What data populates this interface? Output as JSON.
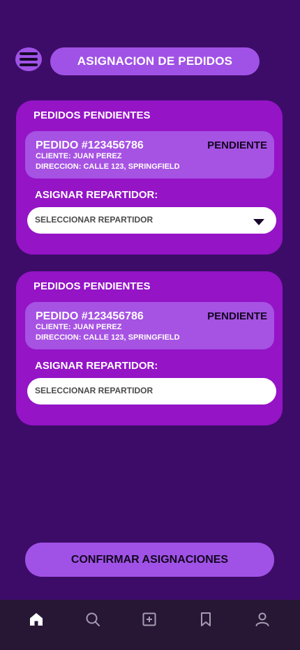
{
  "header": {
    "title": "ASIGNACION DE PEDIDOS",
    "menu_icon": "menu-icon"
  },
  "cards": [
    {
      "title": "PEDIDOS PENDIENTES",
      "order_id": "PEDIDO #123456786",
      "status": "PENDIENTE",
      "client": "CLIENTE: JUAN PEREZ",
      "address": "DIRECCION: CALLE 123, SPRINGFIELD",
      "assign_label": "ASIGNAR REPARTIDOR:",
      "select_value": "SELECCIONAR REPARTIDOR",
      "has_dropdown_icon": true
    },
    {
      "title": "PEDIDOS PENDIENTES",
      "order_id": "PEDIDO #123456786",
      "status": "PENDIENTE",
      "client": "CLIENTE: JUAN PEREZ",
      "address": "DIRECCION: CALLE 123, SPRINGFIELD",
      "assign_label": "ASIGNAR REPARTIDOR:",
      "select_value": "SELECCIONAR REPARTIDOR",
      "has_dropdown_icon": false
    }
  ],
  "confirm_button": "CONFIRMAR ASIGNACIONES",
  "bottom_nav": [
    {
      "icon": "home-icon",
      "active": true
    },
    {
      "icon": "search-icon",
      "active": false
    },
    {
      "icon": "add-icon",
      "active": false
    },
    {
      "icon": "bookmark-icon",
      "active": false
    },
    {
      "icon": "user-icon",
      "active": false
    }
  ],
  "colors": {
    "background": "#3d0c68",
    "card": "#9414c6",
    "accent": "#a052e6",
    "nav_background": "#271735"
  }
}
